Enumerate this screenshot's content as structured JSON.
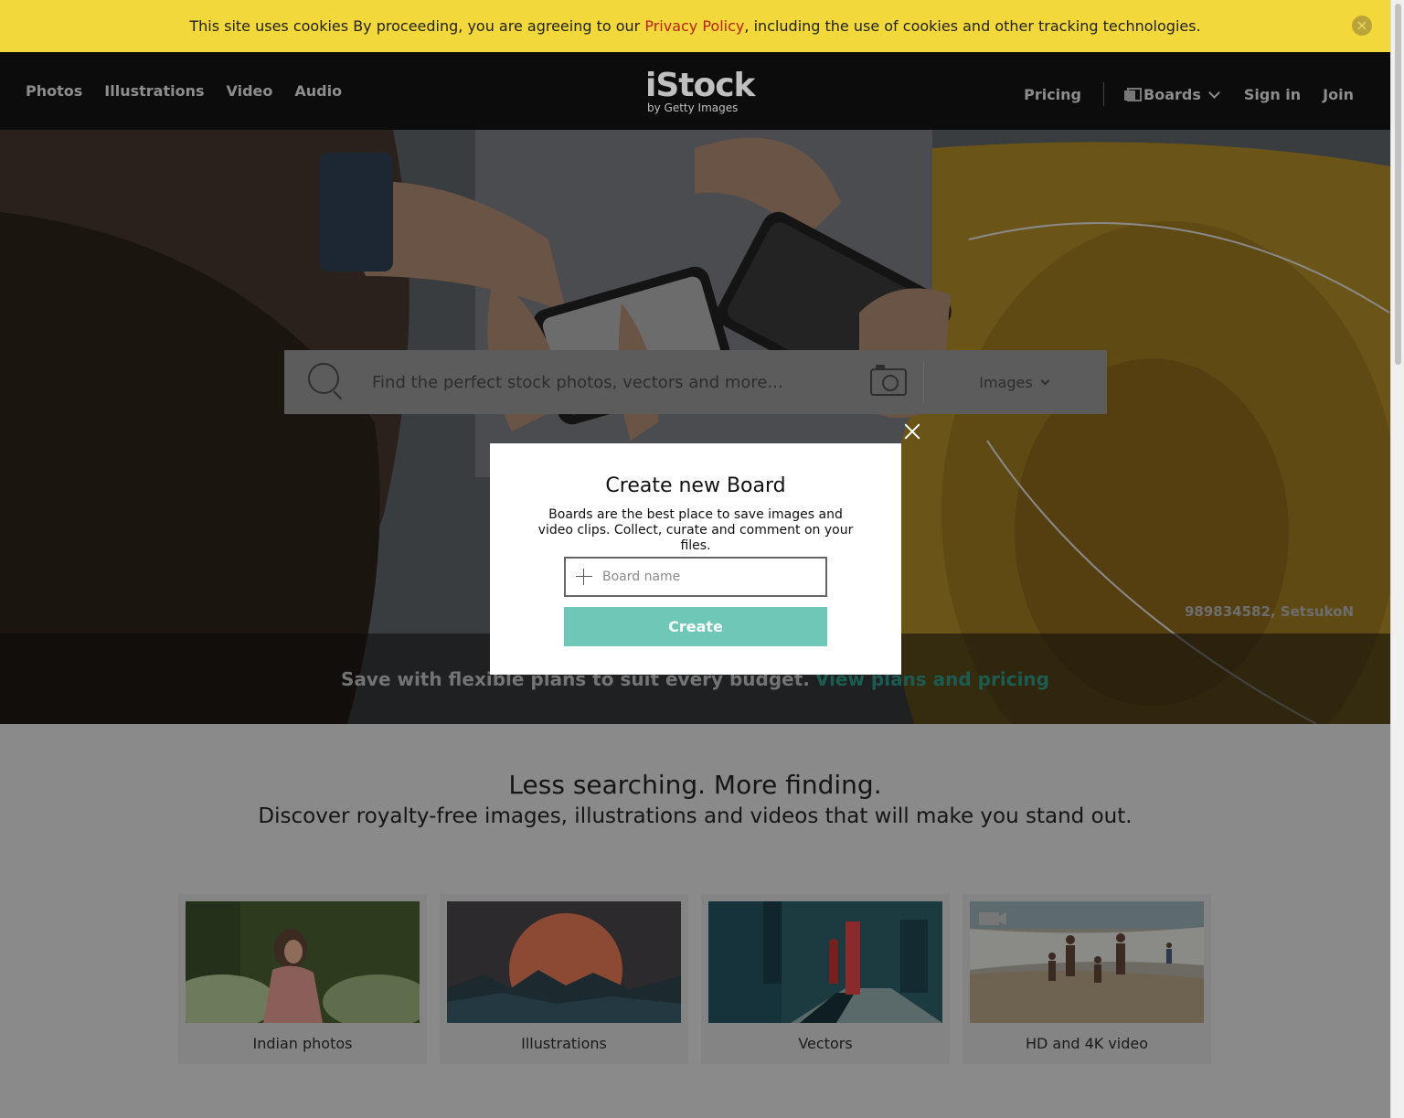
{
  "cookie_bar": {
    "text_before": "This site uses cookies By proceeding, you are agreeing to our ",
    "link": "Privacy Policy",
    "text_after": ", including the use of cookies and other tracking technologies.",
    "close_icon": "close-icon"
  },
  "header": {
    "nav_left": [
      "Photos",
      "Illustrations",
      "Video",
      "Audio"
    ],
    "logo": {
      "wordmark": "iStock",
      "tagline": "by Getty Images"
    },
    "pricing": "Pricing",
    "boards": "Boards",
    "sign_in": "Sign in",
    "join": "Join"
  },
  "search": {
    "placeholder": "Find the perfect stock photos, vectors and more...",
    "type": "Images"
  },
  "hero": {
    "credit": "989834582, SetsukoN",
    "promo_text": "Save with flexible plans to suit every budget.",
    "promo_link": "View plans and pricing"
  },
  "section": {
    "headline": "Less searching. More finding.",
    "subhead": "Discover royalty-free images, illustrations and videos that will make you stand out."
  },
  "cards": [
    {
      "label": "Indian photos"
    },
    {
      "label": "Illustrations"
    },
    {
      "label": "Vectors"
    },
    {
      "label": "HD and 4K video"
    }
  ],
  "modal": {
    "title": "Create new Board",
    "description": "Boards are the best place to save images and video clips. Collect, curate and comment on your files.",
    "input_placeholder": "Board name",
    "create_label": "Create"
  },
  "colors": {
    "cookie_bar": "#f2d83a",
    "create_button": "#6fc7b7",
    "privacy_link": "#b8231e"
  }
}
